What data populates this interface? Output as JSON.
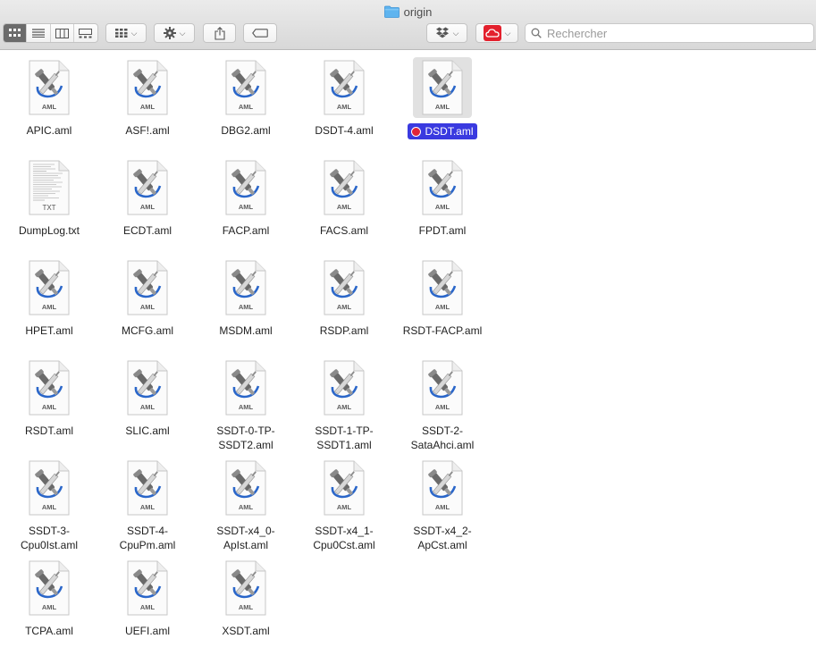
{
  "window": {
    "title": "origin"
  },
  "toolbar": {
    "view_icons": [
      "icon-view-icon",
      "list-view-icon",
      "column-view-icon",
      "gallery-view-icon"
    ],
    "active_view": "icon-view-icon",
    "search_placeholder": "Rechercher"
  },
  "colors": {
    "selection": "#3a3ae0",
    "tag_red": "#e0243a",
    "aml_blue": "#2a66c9"
  },
  "files": [
    {
      "name": "APIC.aml",
      "type": "AML"
    },
    {
      "name": "ASF!.aml",
      "type": "AML"
    },
    {
      "name": "DBG2.aml",
      "type": "AML"
    },
    {
      "name": "DSDT-4.aml",
      "type": "AML"
    },
    {
      "name": "DSDT.aml",
      "type": "AML",
      "selected": true,
      "tag": "red"
    },
    {
      "name": "DumpLog.txt",
      "type": "TXT"
    },
    {
      "name": "ECDT.aml",
      "type": "AML"
    },
    {
      "name": "FACP.aml",
      "type": "AML"
    },
    {
      "name": "FACS.aml",
      "type": "AML"
    },
    {
      "name": "FPDT.aml",
      "type": "AML"
    },
    {
      "name": "HPET.aml",
      "type": "AML"
    },
    {
      "name": "MCFG.aml",
      "type": "AML"
    },
    {
      "name": "MSDM.aml",
      "type": "AML"
    },
    {
      "name": "RSDP.aml",
      "type": "AML"
    },
    {
      "name": "RSDT-FACP.aml",
      "type": "AML"
    },
    {
      "name": "RSDT.aml",
      "type": "AML"
    },
    {
      "name": "SLIC.aml",
      "type": "AML"
    },
    {
      "name": "SSDT-0-TP-SSDT2.aml",
      "label_lines": [
        "SSDT-0-TP-",
        "SSDT2.aml"
      ],
      "type": "AML"
    },
    {
      "name": "SSDT-1-TP-SSDT1.aml",
      "label_lines": [
        "SSDT-1-TP-",
        "SSDT1.aml"
      ],
      "type": "AML"
    },
    {
      "name": "SSDT-2-SataAhci.aml",
      "label_lines": [
        "SSDT-2-",
        "SataAhci.aml"
      ],
      "type": "AML"
    },
    {
      "name": "SSDT-3-Cpu0Ist.aml",
      "label_lines": [
        "SSDT-3-",
        "Cpu0Ist.aml"
      ],
      "type": "AML"
    },
    {
      "name": "SSDT-4-CpuPm.aml",
      "label_lines": [
        "SSDT-4-",
        "CpuPm.aml"
      ],
      "type": "AML"
    },
    {
      "name": "SSDT-x4_0-ApIst.aml",
      "label_lines": [
        "SSDT-x4_0-",
        "ApIst.aml"
      ],
      "type": "AML"
    },
    {
      "name": "SSDT-x4_1-Cpu0Cst.aml",
      "label_lines": [
        "SSDT-x4_1-",
        "Cpu0Cst.aml"
      ],
      "type": "AML"
    },
    {
      "name": "SSDT-x4_2-ApCst.aml",
      "label_lines": [
        "SSDT-x4_2-",
        "ApCst.aml"
      ],
      "type": "AML"
    },
    {
      "name": "TCPA.aml",
      "type": "AML"
    },
    {
      "name": "UEFI.aml",
      "type": "AML"
    },
    {
      "name": "XSDT.aml",
      "type": "AML"
    }
  ]
}
